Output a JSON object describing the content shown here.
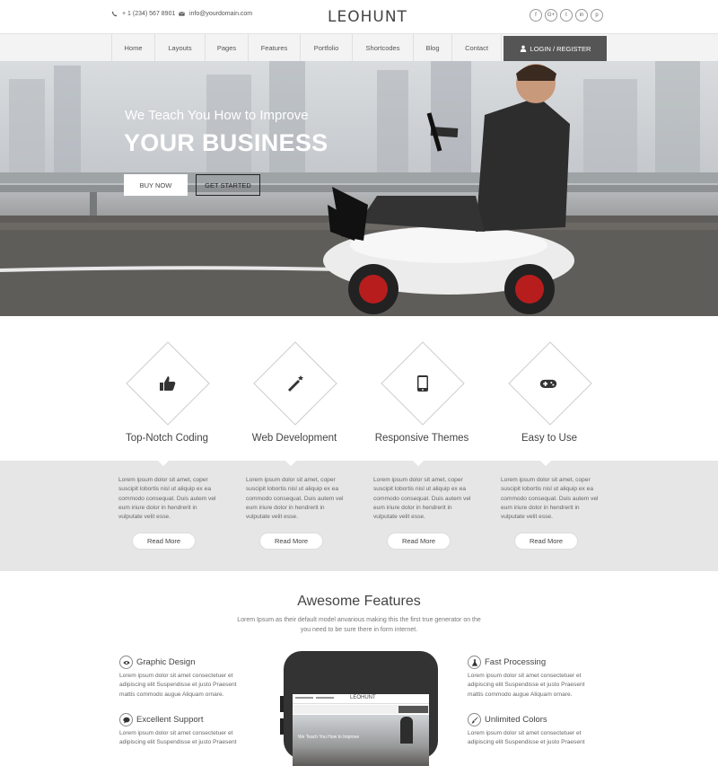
{
  "topbar": {
    "phone": "+ 1 (234) 567 8901",
    "email": "info@yourdomain.com",
    "logo": "LEOHUNT",
    "socials": [
      "f",
      "G+",
      "t",
      "in",
      "p"
    ]
  },
  "nav": {
    "items": [
      "Home",
      "Layouts",
      "Pages",
      "Features",
      "Portfolio",
      "Shortcodes",
      "Blog",
      "Contact"
    ],
    "login": "LOGIN / REGISTER"
  },
  "hero": {
    "subtitle": "We Teach You How to Improve",
    "title": "YOUR BUSINESS",
    "buy_label": "BUY NOW",
    "start_label": "GET STARTED"
  },
  "services": [
    {
      "title": "Top-Notch Coding",
      "icon": "thumbs-up-icon",
      "text": "Lorem ipsum dolor sit amet, coper suscipit lobortis nisl ut aliquip ex ea commodo consequat. Duis autem vel eum iriure dolor in hendrerit in vulputate velit esse.",
      "button": "Read More"
    },
    {
      "title": "Web Development",
      "icon": "magic-wand-icon",
      "text": "Lorem ipsum dolor sit amet, coper suscipit lobortis nisl ut aliquip ex ea commodo consequat. Duis autem vel eum iriure dolor in hendrerit in vulputate velit esse.",
      "button": "Read More"
    },
    {
      "title": "Responsive Themes",
      "icon": "tablet-icon",
      "text": "Lorem ipsum dolor sit amet, coper suscipit lobortis nisl ut aliquip ex ea commodo consequat. Duis autem vel eum iriure dolor in hendrerit in vulputate velit esse.",
      "button": "Read More"
    },
    {
      "title": "Easy to Use",
      "icon": "gamepad-icon",
      "text": "Lorem ipsum dolor sit amet, coper suscipit lobortis nisl ut aliquip ex ea commodo consequat. Duis autem vel eum iriure dolor in hendrerit in vulputate velit esse.",
      "button": "Read More"
    }
  ],
  "features": {
    "title": "Awesome Features",
    "desc": "Lorem Ipsum as their default model anvarious making this the first true generator on the you need to be sure there in form internet.",
    "items": [
      {
        "name": "Graphic Design",
        "icon": "eye-icon",
        "text": "Lorem ipsum dolor sit amet consectetuer et adipiscing elit Suspendisse et justo Praesent mattis commodo augue Aliquam ornare."
      },
      {
        "name": "Fast Processing",
        "icon": "flask-icon",
        "text": "Lorem ipsum dolor sit amet consectetuer et adipiscing elit Suspendisse et justo Praesent mattis commodo augue Aliquam ornare."
      },
      {
        "name": "Excellent Support",
        "icon": "chat-icon",
        "text": "Lorem ipsum dolor sit amet consectetuer et adipiscing elit Suspendisse et justo Praesent"
      },
      {
        "name": "Unlimited Colors",
        "icon": "brush-icon",
        "text": "Lorem ipsum dolor sit amet consectetuer et adipiscing elit Suspendisse et justo Praesent"
      }
    ],
    "phone_logo": "LEOHUNT",
    "phone_hero": "We Teach You How to Improve"
  }
}
